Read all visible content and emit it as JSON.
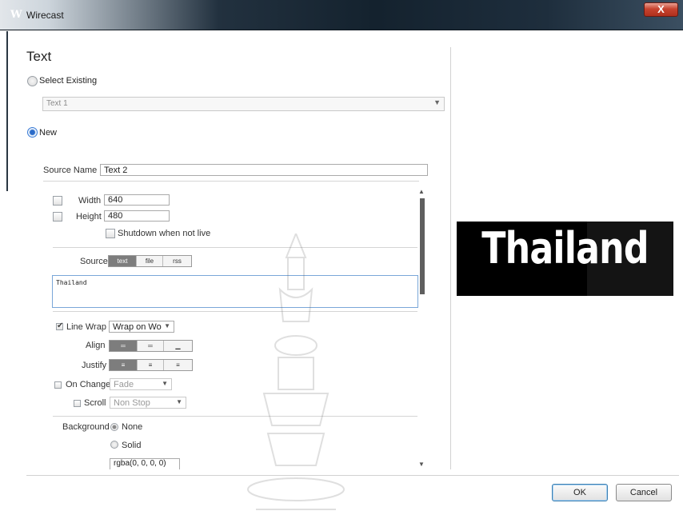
{
  "window": {
    "title": "Wirecast",
    "close_label": "X",
    "logo_glyph": "W"
  },
  "page": {
    "heading": "Text"
  },
  "source_choice": {
    "select_existing_label": "Select Existing",
    "existing_value": "Text 1",
    "new_label": "New",
    "selected": "New"
  },
  "source_name": {
    "label": "Source Name",
    "value": "Text 2"
  },
  "size": {
    "width_label": "Width",
    "width_value": "640",
    "height_label": "Height",
    "height_value": "480",
    "shutdown_label": "Shutdown when not live"
  },
  "source": {
    "label": "Source",
    "tabs": [
      "text",
      "file",
      "rss"
    ],
    "active_tab": "text",
    "text_value": "Thailand"
  },
  "formatting": {
    "line_wrap_label": "Line Wrap",
    "line_wrap_checked": true,
    "line_wrap_value": "Wrap on Wo",
    "align_label": "Align",
    "align_active": 0,
    "justify_label": "Justify",
    "justify_active": 0,
    "on_change_label": "On Change",
    "on_change_value": "Fade",
    "scroll_label": "Scroll",
    "scroll_value": "Non Stop"
  },
  "background": {
    "label": "Background",
    "options": [
      "None",
      "Solid"
    ],
    "selected": "None",
    "color_value": "rgba(0, 0, 0, 0)"
  },
  "preview": {
    "text": "Thailand"
  },
  "buttons": {
    "ok": "OK",
    "cancel": "Cancel"
  },
  "colors": {
    "accent": "#3c7fb1",
    "preview_bg": "#000000",
    "preview_text": "#ffffff"
  }
}
